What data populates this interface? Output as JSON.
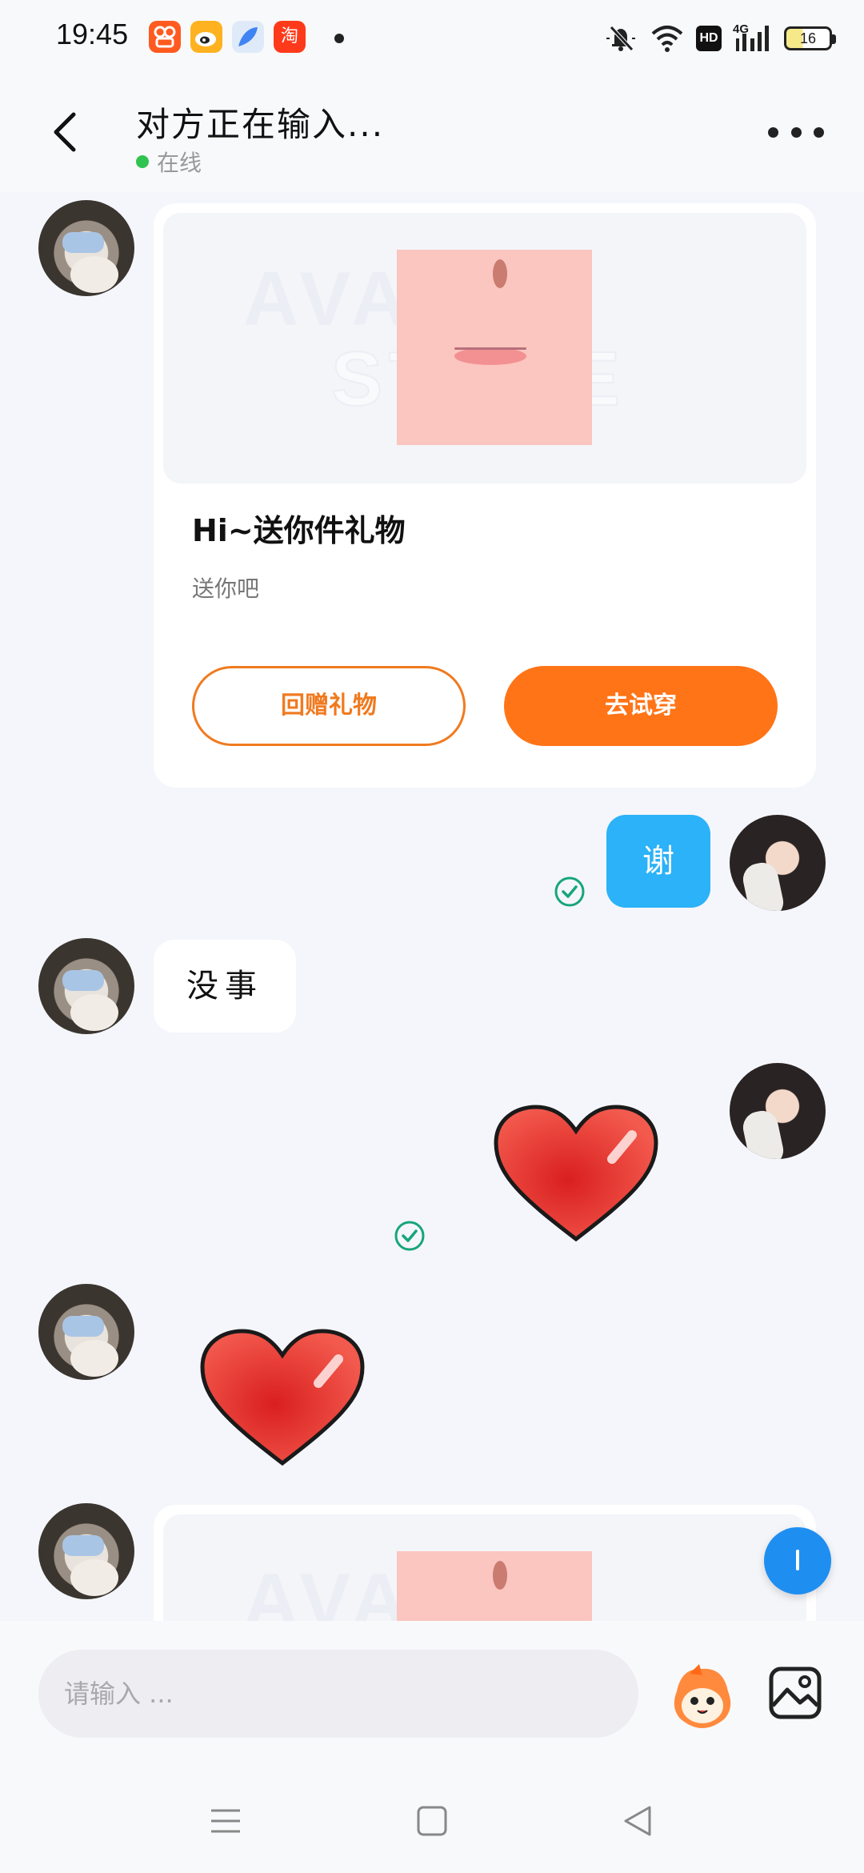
{
  "status_bar": {
    "time": "19:45",
    "apps": [
      {
        "icon": "kuaishou-app-icon",
        "color": "#ff5a1f"
      },
      {
        "icon": "weibo-app-icon",
        "color": "#ffb21f"
      },
      {
        "icon": "feather-app-icon",
        "color": "#3f84f2"
      },
      {
        "icon": "taobao-app-icon",
        "color": "#ff3a1a",
        "glyph": "淘"
      }
    ],
    "hd_label": "HD",
    "network_label": "4G",
    "battery_level": "16"
  },
  "header": {
    "title": "对方正在输入...",
    "status_text": "在线",
    "status_color": "#30c350"
  },
  "messages": {
    "gift_card": {
      "title": "Hi~送你件礼物",
      "subtitle": "送你吧",
      "return_gift_label": "回赠礼物",
      "try_on_label": "去试穿",
      "accent_color": "#ff7417"
    },
    "self_text": "谢",
    "self_bubble_color": "#2bb2f8",
    "other_text": "没事"
  },
  "input": {
    "placeholder": "请输入 ..."
  },
  "icons": {
    "emoji": "mascot-emoji-icon",
    "image": "image-icon",
    "nav_menu": "menu-icon",
    "nav_home": "home-icon",
    "nav_back": "back-triangle-icon"
  }
}
